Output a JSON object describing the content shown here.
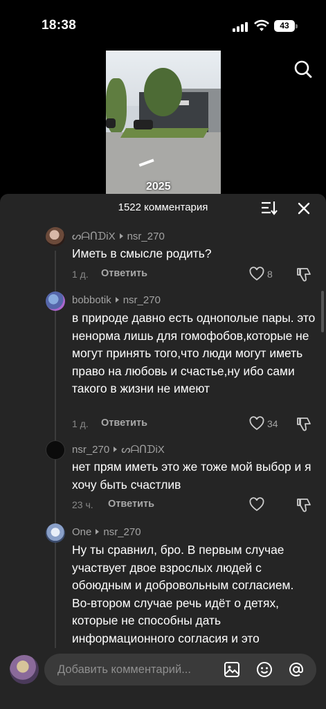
{
  "status_bar": {
    "time": "18:38",
    "battery": "43"
  },
  "video": {
    "year_text": "2025"
  },
  "comments_panel": {
    "count_label": "1522 комментария",
    "comments": [
      {
        "author": "ᔕᗩᑎᗪiX",
        "reply_to": "nsr_270",
        "text": "Иметь в смысле родить?",
        "time": "1 д.",
        "reply_label": "Ответить",
        "likes": "8"
      },
      {
        "author": "bobbotik",
        "reply_to": "nsr_270",
        "text": "в природе давно есть однополые пары. это ненорма лишь для гомофобов,которые не могут принять того,что люди могут иметь право на любовь и счастье,ну ибо сами такого в жизни не имеют",
        "time": "1 д.",
        "reply_label": "Ответить",
        "likes": "34"
      },
      {
        "author": "nsr_270",
        "reply_to": "ᔕᗩᑎᗪiX",
        "text": "нет прям иметь это же тоже мой выбор и я хочу быть счастлив",
        "time": "23 ч.",
        "reply_label": "Ответить",
        "likes": ""
      },
      {
        "author": "One",
        "reply_to": "nsr_270",
        "text": "Ну ты сравнил, бро. В первым случае участвует двое взрослых людей с обоюдным и добровольным согласием. Во-втором случае речь идёт о детях, которые не способны дать информационного согласия и это считается насильственным действием и"
      }
    ]
  },
  "input_bar": {
    "placeholder": "Добавить комментарий..."
  },
  "icons": {
    "search": "search-icon",
    "sort": "sort-icon",
    "close": "close-icon",
    "like": "heart-icon",
    "dislike": "thumb-down-icon",
    "image": "image-icon",
    "emoji": "emoji-icon",
    "mention": "at-icon"
  }
}
